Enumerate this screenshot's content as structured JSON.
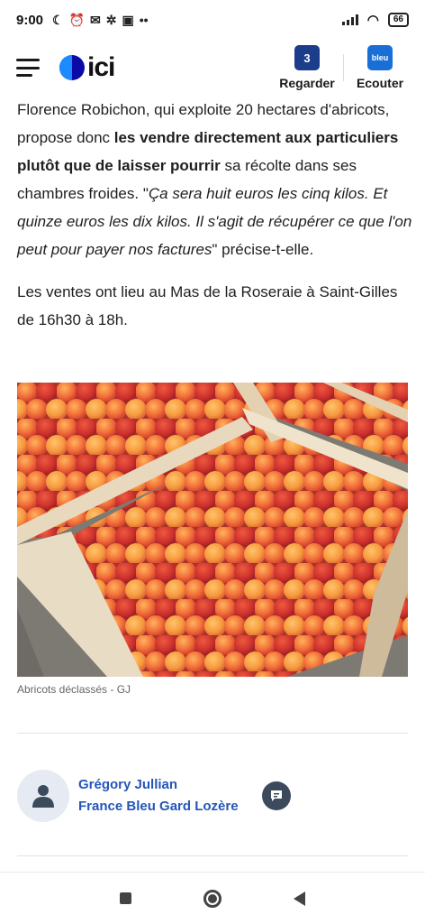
{
  "status_bar": {
    "time": "9:00",
    "battery": "66"
  },
  "header": {
    "logo_text": "ici",
    "actions": [
      {
        "badge": "3",
        "label": "Regarder"
      },
      {
        "badge": "bleu",
        "label": "Ecouter"
      }
    ]
  },
  "article": {
    "p1_a": "Florence Robichon, qui exploite 20 hectares d'abricots, propose donc ",
    "p1_bold": "les vendre directement aux particuliers plutôt que de laisser pourrir",
    "p1_b": " sa récolte dans ses chambres froides. \"",
    "p1_quote": "Ça sera huit euros les cinq kilos. Et quinze euros les dix kilos. Il s'agit de récupérer ce que l'on peut pour payer nos factures",
    "p1_c": "\" précise-t-elle.",
    "p2": "Les ventes ont lieu au Mas de la Roseraie à Saint-Gilles de 16h30 à 18h."
  },
  "photo": {
    "caption": "Abricots déclassés - GJ"
  },
  "author": {
    "name": "Grégory Jullian",
    "station": "France Bleu Gard Lozère"
  },
  "colors": {
    "link": "#2456b8",
    "brand_dark": "#0a0aa8",
    "brand_light": "#1a8cff"
  }
}
